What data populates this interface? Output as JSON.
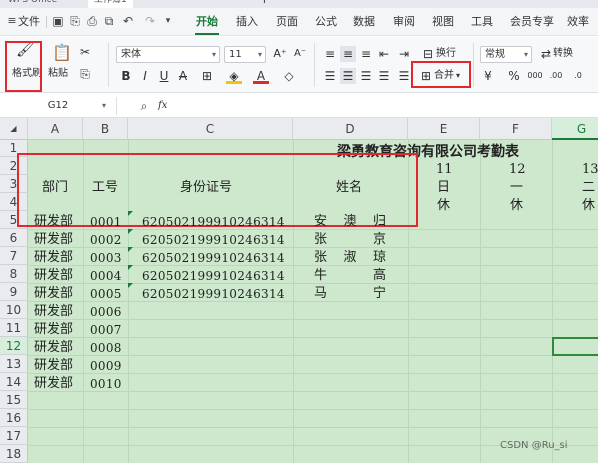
{
  "tabs": {
    "app": "WPS Office",
    "document": "工作簿1",
    "new_tab": "+"
  },
  "menubar": {
    "file": "文件",
    "items": [
      "开始",
      "插入",
      "页面",
      "公式",
      "数据",
      "审阅",
      "视图",
      "工具",
      "会员专享",
      "效率"
    ],
    "active": "开始"
  },
  "ribbon": {
    "format_painter": "格式刷",
    "paste": "粘贴",
    "font_name": "宋体",
    "font_size": "11",
    "wrap": "换行",
    "merge": "合并",
    "number_format": "常规",
    "convert": "转换"
  },
  "formula": {
    "name_box": "G12",
    "fx": "fx",
    "content": ""
  },
  "sheet": {
    "columns": [
      "A",
      "B",
      "C",
      "D",
      "E",
      "F",
      "G"
    ],
    "rows": [
      "1",
      "2",
      "3",
      "4",
      "5",
      "6",
      "7",
      "8",
      "9",
      "10",
      "11",
      "12",
      "13",
      "14",
      "15",
      "16",
      "17",
      "18"
    ],
    "selected_column": "G",
    "selected_row": "12",
    "title": "梁勇教育咨询有限公司考勤表",
    "header": {
      "dept": "部门",
      "id": "工号",
      "idcard": "身份证号",
      "name": "姓名"
    },
    "day_numbers": [
      "11",
      "12",
      "13"
    ],
    "weekdays": [
      "日",
      "一",
      "二"
    ],
    "rest": [
      "休",
      "休",
      "休"
    ],
    "employees": [
      {
        "dept": "研发部",
        "id": "0001",
        "idcard": "620502199910246314",
        "name": [
          "安",
          "澳",
          "归"
        ]
      },
      {
        "dept": "研发部",
        "id": "0002",
        "idcard": "620502199910246314",
        "name": [
          "张",
          "",
          "京"
        ]
      },
      {
        "dept": "研发部",
        "id": "0003",
        "idcard": "620502199910246314",
        "name": [
          "张",
          "淑",
          "琼"
        ]
      },
      {
        "dept": "研发部",
        "id": "0004",
        "idcard": "620502199910246314",
        "name": [
          "牛",
          "",
          "高"
        ]
      },
      {
        "dept": "研发部",
        "id": "0005",
        "idcard": "620502199910246314",
        "name": [
          "马",
          "",
          "宁"
        ]
      },
      {
        "dept": "研发部",
        "id": "0006",
        "idcard": "",
        "name": []
      },
      {
        "dept": "研发部",
        "id": "0007",
        "idcard": "",
        "name": []
      },
      {
        "dept": "研发部",
        "id": "0008",
        "idcard": "",
        "name": []
      },
      {
        "dept": "研发部",
        "id": "0009",
        "idcard": "",
        "name": []
      },
      {
        "dept": "研发部",
        "id": "0010",
        "idcard": "",
        "name": []
      }
    ]
  },
  "watermark": "CSDN @Ru_si",
  "colors": {
    "accent": "#1b7a3a",
    "sheet_bg": "#cde8cd",
    "highlight_box": "#e0282e"
  }
}
